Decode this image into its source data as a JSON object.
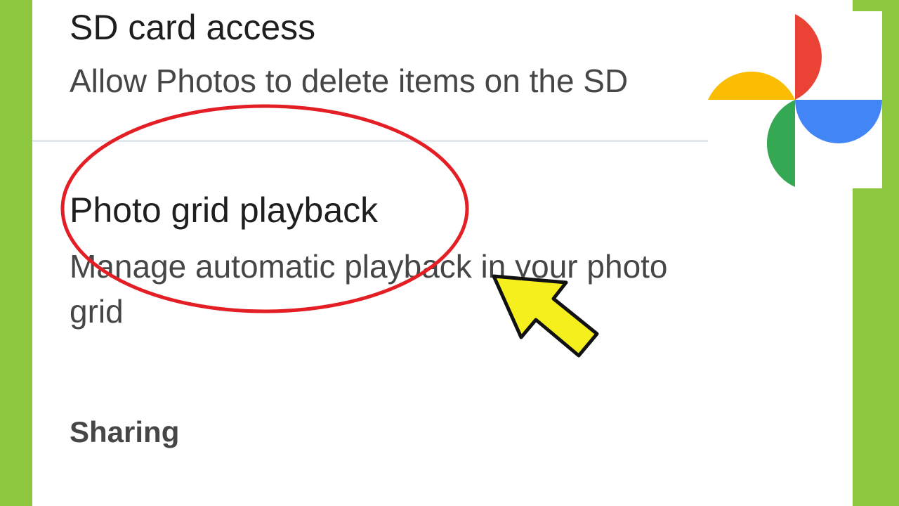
{
  "settings": {
    "sd_card": {
      "title": "SD card access",
      "description": "Allow Photos to delete items on the SD"
    },
    "photo_grid": {
      "title": "Photo grid playback",
      "description_line1": "Manage automatic playback in your photo",
      "description_line2": "grid"
    },
    "sharing_header": "Sharing"
  },
  "logo": {
    "name": "google-photos-logo",
    "colors": {
      "red": "#ea4335",
      "yellow": "#fbbc04",
      "green": "#34a853",
      "blue": "#4285f4"
    }
  },
  "annotations": {
    "highlight_color": "#e31e24",
    "arrow_color": "#f5f01d",
    "frame_color": "#8dc63f"
  }
}
